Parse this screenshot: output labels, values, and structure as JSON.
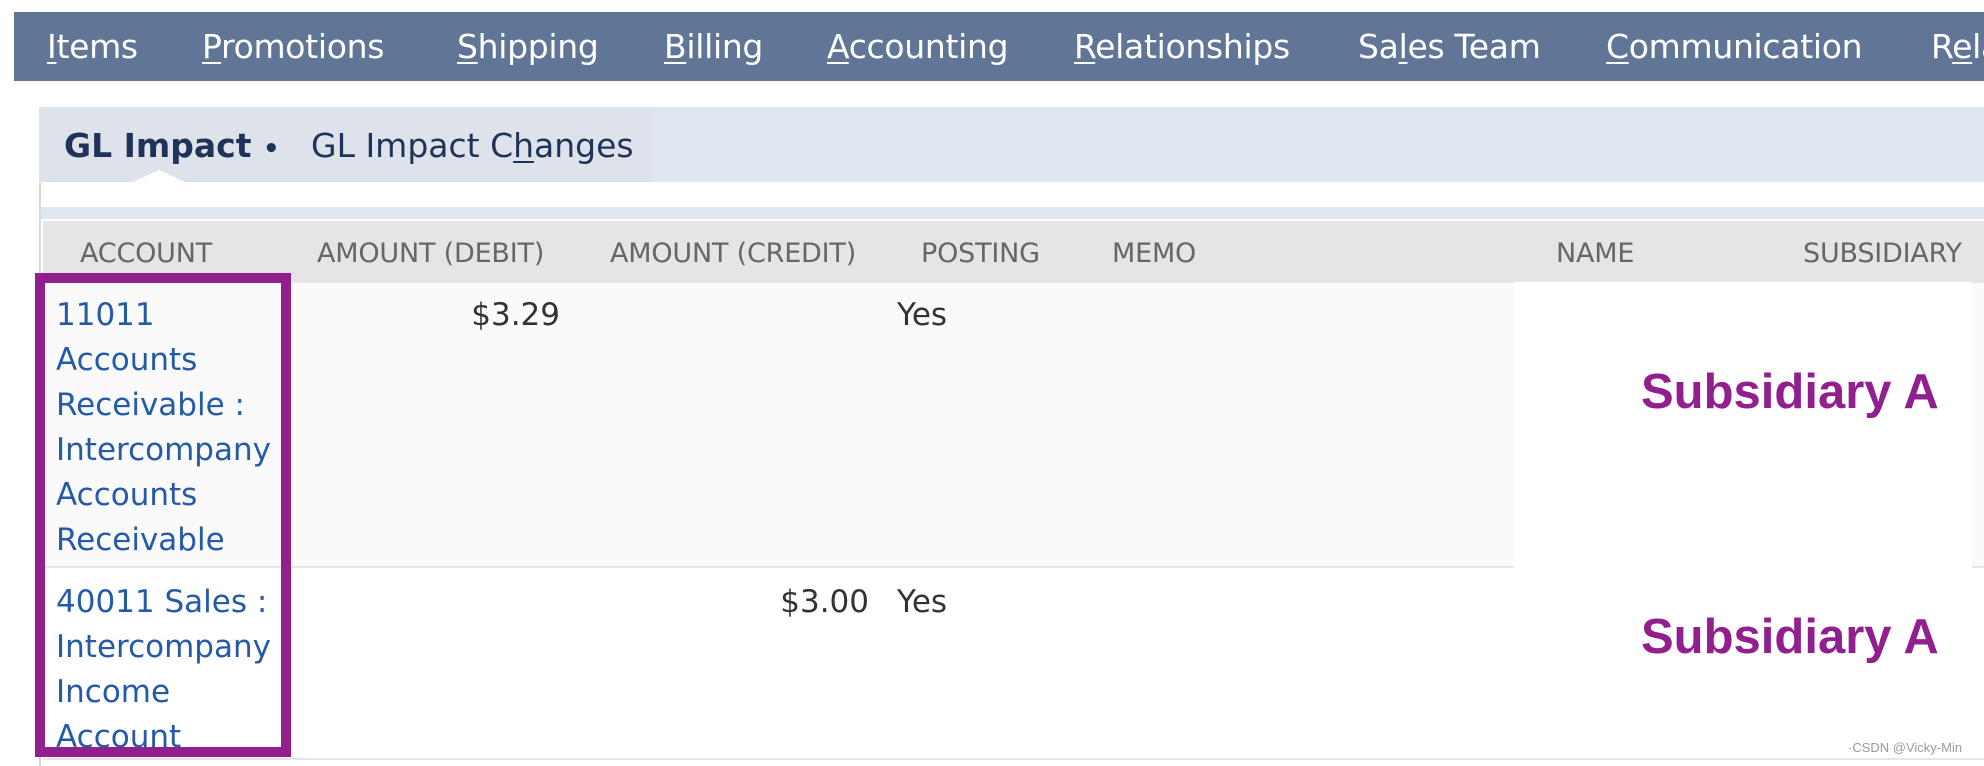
{
  "nav": {
    "items": [
      {
        "pre": "",
        "key": "I",
        "post": "tems"
      },
      {
        "pre": "",
        "key": "P",
        "post": "romotions"
      },
      {
        "pre": "",
        "key": "S",
        "post": "hipping"
      },
      {
        "pre": "",
        "key": "B",
        "post": "illing"
      },
      {
        "pre": "",
        "key": "A",
        "post": "ccounting"
      },
      {
        "pre": "",
        "key": "R",
        "post": "elationships"
      },
      {
        "pre": "Sa",
        "key": "l",
        "post": "es Team"
      },
      {
        "pre": "",
        "key": "C",
        "post": "ommunication"
      },
      {
        "pre": "R",
        "key": "e",
        "post": "lated Records"
      }
    ]
  },
  "tabs": {
    "active": {
      "label": "GL Impact",
      "marker": "•"
    },
    "other": {
      "pre": "GL Impact C",
      "key": "h",
      "post": "anges"
    }
  },
  "table": {
    "headers": {
      "account": "ACCOUNT",
      "debit": "AMOUNT (DEBIT)",
      "credit": "AMOUNT (CREDIT)",
      "posting": "POSTING",
      "memo": "MEMO",
      "name": "NAME",
      "subsidiary": "SUBSIDIARY"
    },
    "rows": [
      {
        "account_lines": [
          "11011",
          "Accounts",
          "Receivable :",
          "Intercompany",
          "Accounts",
          "Receivable"
        ],
        "debit": "$3.29",
        "credit": "",
        "posting": "Yes",
        "memo": "",
        "name": "",
        "subsidiary_annotation": "Subsidiary A"
      },
      {
        "account_lines": [
          "40011 Sales :",
          "Intercompany",
          "Income",
          "Account"
        ],
        "debit": "",
        "credit": "$3.00",
        "posting": "Yes",
        "memo": "",
        "name": "",
        "subsidiary_annotation": "Subsidiary A"
      }
    ]
  },
  "annotation": {
    "highlight_color": "#921f8e",
    "watermark": "·CSDN @Vicky-Min"
  },
  "colors": {
    "nav_bg": "#617697",
    "tab_bg": "#dfe6f0",
    "header_bg": "#e5e5e5",
    "link": "#255aa8"
  }
}
